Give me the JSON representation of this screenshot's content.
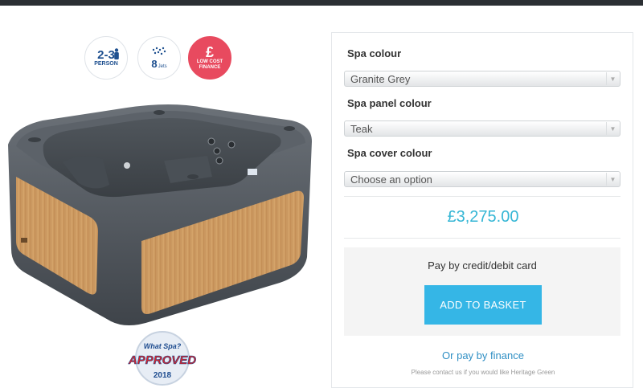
{
  "badges": {
    "person_num": "2-3",
    "person_sub": "PERSON",
    "jets_num": "8",
    "jets_sub": "Jets",
    "finance_symbol": "£",
    "finance_sub": "LOW COST FINANCE"
  },
  "award": {
    "top": "What Spa?",
    "main": "APPROVED",
    "year": "2018"
  },
  "options": {
    "spa_colour_label": "Spa colour",
    "spa_colour_value": "Granite Grey",
    "panel_colour_label": "Spa panel colour",
    "panel_colour_value": "Teak",
    "cover_colour_label": "Spa cover colour",
    "cover_colour_value": "Choose an option"
  },
  "price": "£3,275.00",
  "payment": {
    "card_text": "Pay by credit/debit card",
    "basket_button": "ADD TO BASKET",
    "finance_link": "Or pay by finance",
    "contact_note": "Please contact us if you would like Heritage Green"
  },
  "colors": {
    "accent": "#35b6e6",
    "price": "#35b6d5",
    "finance_badge": "#e84a5f"
  }
}
